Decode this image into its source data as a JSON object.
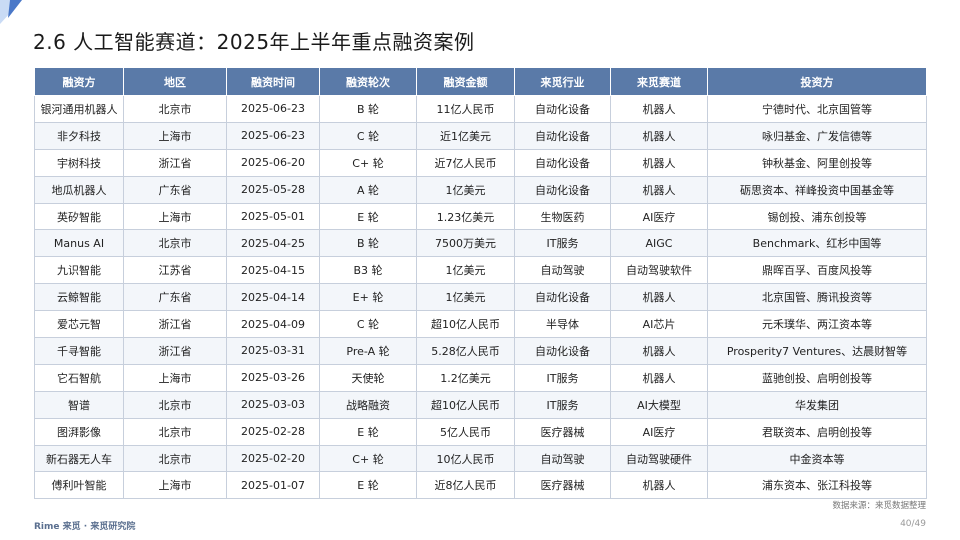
{
  "title": "2.6 人工智能赛道：2025年上半年重点融资案例",
  "table": {
    "headers": [
      "融资方",
      "地区",
      "融资时间",
      "融资轮次",
      "融资金额",
      "来觅行业",
      "来觅赛道",
      "投资方"
    ],
    "rows": [
      [
        "银河通用机器人",
        "北京市",
        "2025-06-23",
        "B 轮",
        "11亿人民币",
        "自动化设备",
        "机器人",
        "宁德时代、北京国管等"
      ],
      [
        "非夕科技",
        "上海市",
        "2025-06-23",
        "C 轮",
        "近1亿美元",
        "自动化设备",
        "机器人",
        "咏归基金、广发信德等"
      ],
      [
        "宇树科技",
        "浙江省",
        "2025-06-20",
        "C+ 轮",
        "近7亿人民币",
        "自动化设备",
        "机器人",
        "钟秋基金、阿里创投等"
      ],
      [
        "地瓜机器人",
        "广东省",
        "2025-05-28",
        "A 轮",
        "1亿美元",
        "自动化设备",
        "机器人",
        "砺思资本、祥峰投资中国基金等"
      ],
      [
        "英矽智能",
        "上海市",
        "2025-05-01",
        "E 轮",
        "1.23亿美元",
        "生物医药",
        "AI医疗",
        "锡创投、浦东创投等"
      ],
      [
        "Manus AI",
        "北京市",
        "2025-04-25",
        "B 轮",
        "7500万美元",
        "IT服务",
        "AIGC",
        "Benchmark、红杉中国等"
      ],
      [
        "九识智能",
        "江苏省",
        "2025-04-15",
        "B3 轮",
        "1亿美元",
        "自动驾驶",
        "自动驾驶软件",
        "鼎晖百孚、百度风投等"
      ],
      [
        "云鲸智能",
        "广东省",
        "2025-04-14",
        "E+ 轮",
        "1亿美元",
        "自动化设备",
        "机器人",
        "北京国管、腾讯投资等"
      ],
      [
        "爱芯元智",
        "浙江省",
        "2025-04-09",
        "C 轮",
        "超10亿人民币",
        "半导体",
        "AI芯片",
        "元禾璞华、两江资本等"
      ],
      [
        "千寻智能",
        "浙江省",
        "2025-03-31",
        "Pre-A 轮",
        "5.28亿人民币",
        "自动化设备",
        "机器人",
        "Prosperity7 Ventures、达晨财智等"
      ],
      [
        "它石智航",
        "上海市",
        "2025-03-26",
        "天使轮",
        "1.2亿美元",
        "IT服务",
        "机器人",
        "蓝驰创投、启明创投等"
      ],
      [
        "智谱",
        "北京市",
        "2025-03-03",
        "战略融资",
        "超10亿人民币",
        "IT服务",
        "AI大模型",
        "华发集团"
      ],
      [
        "图湃影像",
        "北京市",
        "2025-02-28",
        "E 轮",
        "5亿人民币",
        "医疗器械",
        "AI医疗",
        "君联资本、启明创投等"
      ],
      [
        "新石器无人车",
        "北京市",
        "2025-02-20",
        "C+ 轮",
        "10亿人民币",
        "自动驾驶",
        "自动驾驶硬件",
        "中金资本等"
      ],
      [
        "傅利叶智能",
        "上海市",
        "2025-01-07",
        "E 轮",
        "近8亿人民币",
        "医疗器械",
        "机器人",
        "浦东资本、张江科投等"
      ]
    ]
  },
  "source": "数据来源：来觅数据整理",
  "footer": {
    "logo": "Rime 来觅 · 来觅研究院",
    "page": "40/49"
  },
  "colors": {
    "header_bg": "#5a7aa8",
    "accent": "#4a78c8"
  }
}
